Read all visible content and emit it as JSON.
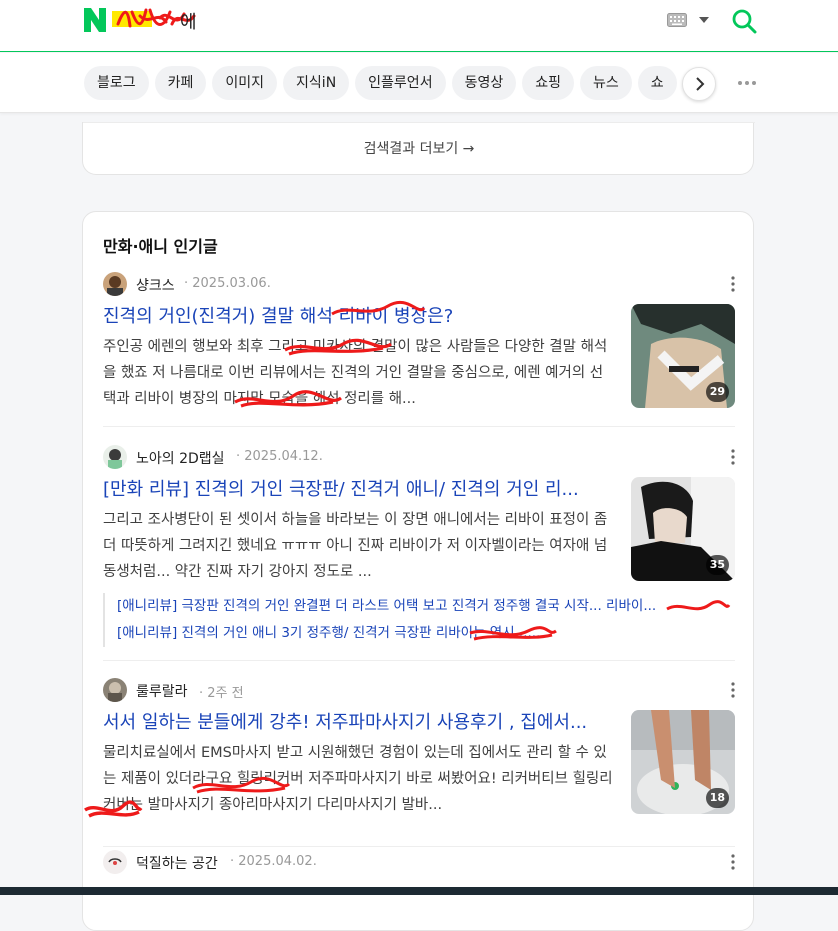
{
  "header": {
    "logo_letter": "N",
    "logo_trailing": "에",
    "colors": {
      "brand_green": "#03c75a",
      "link_blue": "#1a44b8",
      "scribble_red": "#ee1a1a",
      "logo_yellow": "#ffe800"
    }
  },
  "tabs": [
    {
      "label": "블로그"
    },
    {
      "label": "카페"
    },
    {
      "label": "이미지"
    },
    {
      "label": "지식iN"
    },
    {
      "label": "인플루언서"
    },
    {
      "label": "동영상"
    },
    {
      "label": "쇼핑"
    },
    {
      "label": "뉴스"
    },
    {
      "label": "쇼"
    }
  ],
  "more_results": {
    "label": "검색결과 더보기 →"
  },
  "section": {
    "title": "만화·애니 인기글",
    "posts": [
      {
        "author": "샹크스",
        "date": "· 2025.03.06.",
        "title": "진격의 거인(진격거) 결말 해석 리바이 병장은?",
        "body": "주인공 에렌의 행보와 최후 그리고 미카사의 결말이 많은 사람들은 다양한 결말 해석을 했죠 저 나름대로 이번 리뷰에서는 진격의 거인 결말을 중심으로, 에렌 예거의 선택과 리바이 병장의 마지막 모습을 해석 정리를 해...",
        "image_count": "29",
        "related": []
      },
      {
        "author": "노아의 2D랩실",
        "date": "· 2025.04.12.",
        "title": "[만화 리뷰] 진격의 거인 극장판/ 진격거 애니/ 진격의 거인 리...",
        "body": "그리고 조사병단이 된 셋이서 하늘을 바라보는 이 장면 애니에서는 리바이 표정이 좀 더 따뜻하게 그려지긴 했네요 ㅠㅠㅠ 아니 진짜 리바이가 저 이자벨이라는 여자애 넘 동생처럼... 약간 진짜 자기 강아지 정도로 ...",
        "image_count": "35",
        "related": [
          "[애니리뷰] 극장판 진격의 거인 완결편 더 라스트 어택 보고 진격거 정주행 결국 시작... 리바이...",
          "[애니리뷰] 진격의 거인 애니 3기 정주행/ 진격거 극장판 리바이는 역시......"
        ]
      },
      {
        "author": "룰루랄라",
        "date": "· 2주 전",
        "title": "서서 일하는 분들에게 강추! 저주파마사지기 사용후기 , 집에서...",
        "body": "물리치료실에서 EMS마사지 받고 시원해했던 경험이 있는데 집에서도 관리 할 수 있는 제품이 있더라구요 힐링리커버 저주파마사지기 바로 써봤어요! 리커버티브 힐링리커버는 발마사지기 종아리마사지기 다리마사지기 발바...",
        "image_count": "18",
        "related": []
      },
      {
        "author": "덕질하는 공간",
        "date": "· 2025.04.02.",
        "title": "",
        "body": "",
        "image_count": "",
        "related": []
      }
    ]
  }
}
